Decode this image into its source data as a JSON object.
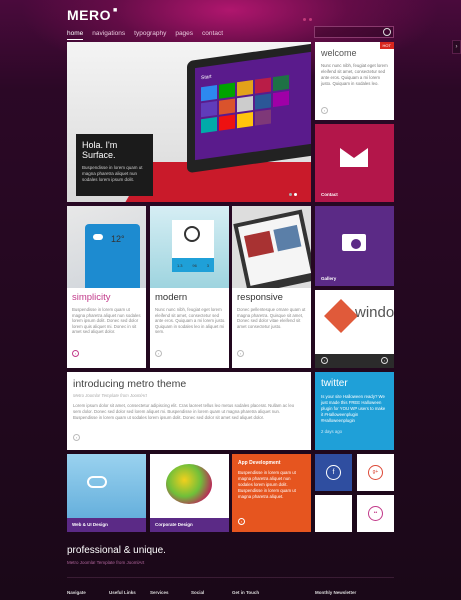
{
  "header": {
    "logo": "MERO",
    "logo_mark": "■",
    "nav": [
      "home",
      "navigations",
      "typography",
      "pages",
      "contact"
    ],
    "active_nav": "home"
  },
  "hero": {
    "heading": "Hola. I'm Surface.",
    "text": "Buspendisse in lorem quam ut magna pharetra aliquet nun sodales lorem ipsum dolit.",
    "screen_label": "Start"
  },
  "welcome": {
    "badge": "HOT",
    "title": "welcome",
    "text": "Nunc nunc nibh, feugiat eget lorem eleifend sit amet, consectetur sed ante eros. Quiquam a mi lorem justo. Quiquam in sodales leo."
  },
  "contact": {
    "label": "Contact"
  },
  "gallery": {
    "label": "Gallery"
  },
  "cards": [
    {
      "title": "simplicity",
      "title_color": "#c23a8a",
      "text": "Buspendisse in lorem quam ut magna pharetra aliquet nun sodales lorem ipsum dolit. Donec sed dolor lorem quis aliquet mi. Donec in sit amet sed aliquet dolor."
    },
    {
      "title": "modern",
      "title_color": "#333333",
      "text": "Nunc nunc nibh, feugiat eget lorem eleifend sit amet, consectetur sed ante eros. Quiquam a mi lorem justo. Quiquam in sodales leo in aliquet mi sem."
    },
    {
      "title": "responsive",
      "title_color": "#333333",
      "text": "Donec pellentesque ornare quam ut magna pharetra. Quisque sit amet, Donec sed dolor vitae eleifend sit amet consectetur justo."
    }
  ],
  "weather_widget": {
    "temp": "12°",
    "stat1": "1.3",
    "stat2": "96",
    "stat3": "3"
  },
  "windows_tile": {
    "text": "windo"
  },
  "intro": {
    "title": "introducing metro theme",
    "subtitle": "Metro Joomla! Template from JoomlArt",
    "text": "Lorem ipsum dolor sit amet, consectetur adipiscing elit. Cras laoreet tellus leo metus sodales placerat. Nullam ac leo sem dolor. Donec sed dolor sed lorem aliquet mi. Buspendisse in lorem quam ut magna pharetra aliquet nun. Buspendisse in lorem quam ut sodales lorem ipsum dolit. Donec sed dolor sit amet sed aliquet dolor."
  },
  "twitter": {
    "title": "twitter",
    "text": "Is your site Halloween ready? We just made this FREE Halloween plugin for YOU WP users to make it #Halloweenplugin #Halloweenplugin",
    "time": "2 days ago"
  },
  "tiles": {
    "web_ui": "Web & UI Design",
    "corporate": "Corporate Design",
    "app_dev_title": "App Development",
    "app_dev_text": "Buspendisse in lorem quam ut magna pharetra aliquet nun sodales lorem ipsum dolit. Buspendisse in lorem quam ut magna pharetra aliquet."
  },
  "social": {
    "facebook": "f",
    "google_plus": "g+",
    "flickr": "••"
  },
  "footer": {
    "tagline": "professional & unique.",
    "subtagline": "Metro Joomla! Template from JoomlArt",
    "columns": [
      "Navigate",
      "Useful Links",
      "Services",
      "Social",
      "Get in Touch",
      "Monthly Newsletter"
    ]
  },
  "colors": {
    "accent_magenta": "#b3164a",
    "purple": "#5b2a86",
    "twitter_blue": "#1fa0d8",
    "orange": "#e6551f",
    "facebook_blue": "#2f4ea0"
  }
}
